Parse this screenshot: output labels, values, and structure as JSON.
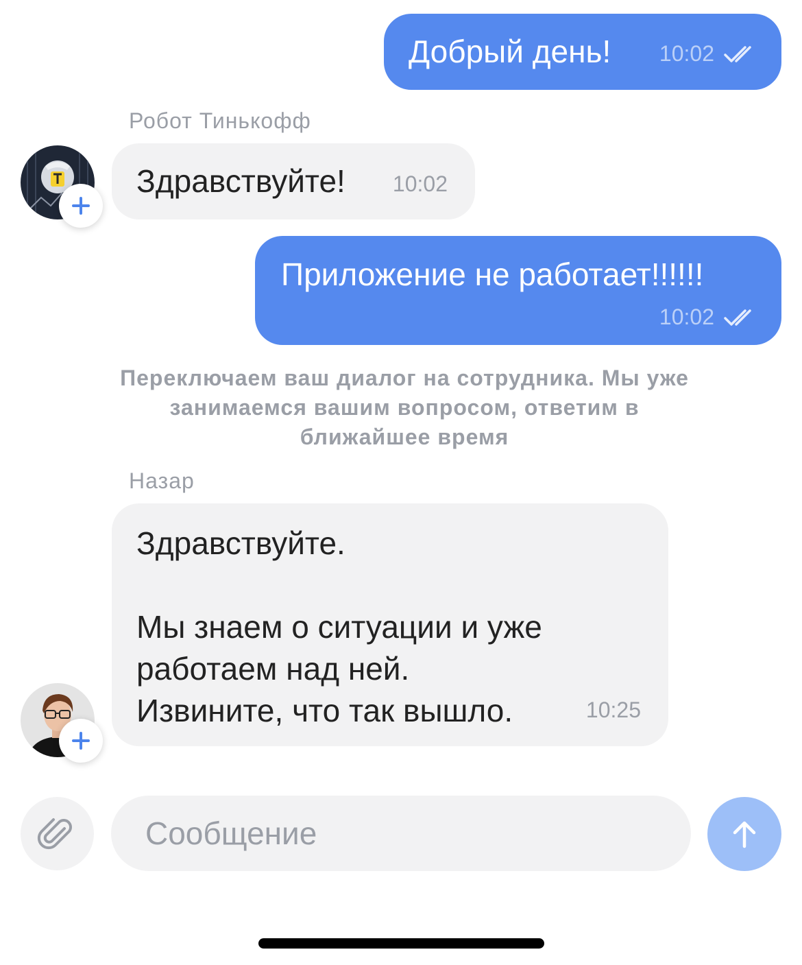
{
  "messages": [
    {
      "direction": "out",
      "text": "Добрый день!",
      "time": "10:02",
      "status": "read"
    },
    {
      "direction": "in",
      "sender": "Робот Тинькофф",
      "text": "Здравствуйте!",
      "time": "10:02"
    },
    {
      "direction": "out",
      "text": "Приложение не работает!!!!!!",
      "time": "10:02",
      "status": "read"
    },
    {
      "direction": "in",
      "sender": "Назар",
      "text": "Здравствуйте.\n\nМы знаем о ситуации и уже\nработаем над ней.\nИзвините, что так вышло.",
      "time": "10:25"
    }
  ],
  "system_notice": "Переключаем ваш диалог на сотрудника. Мы уже занимаемся вашим вопросом, ответим в ближайшее время",
  "composer": {
    "placeholder": "Сообщение",
    "attach_icon": "paperclip-icon",
    "send_icon": "arrow-up-icon"
  },
  "colors": {
    "outgoing_bubble": "#5589ee",
    "incoming_bubble": "#f2f2f3",
    "muted_text": "#9a9ea6",
    "send_button": "#9dbff8"
  }
}
